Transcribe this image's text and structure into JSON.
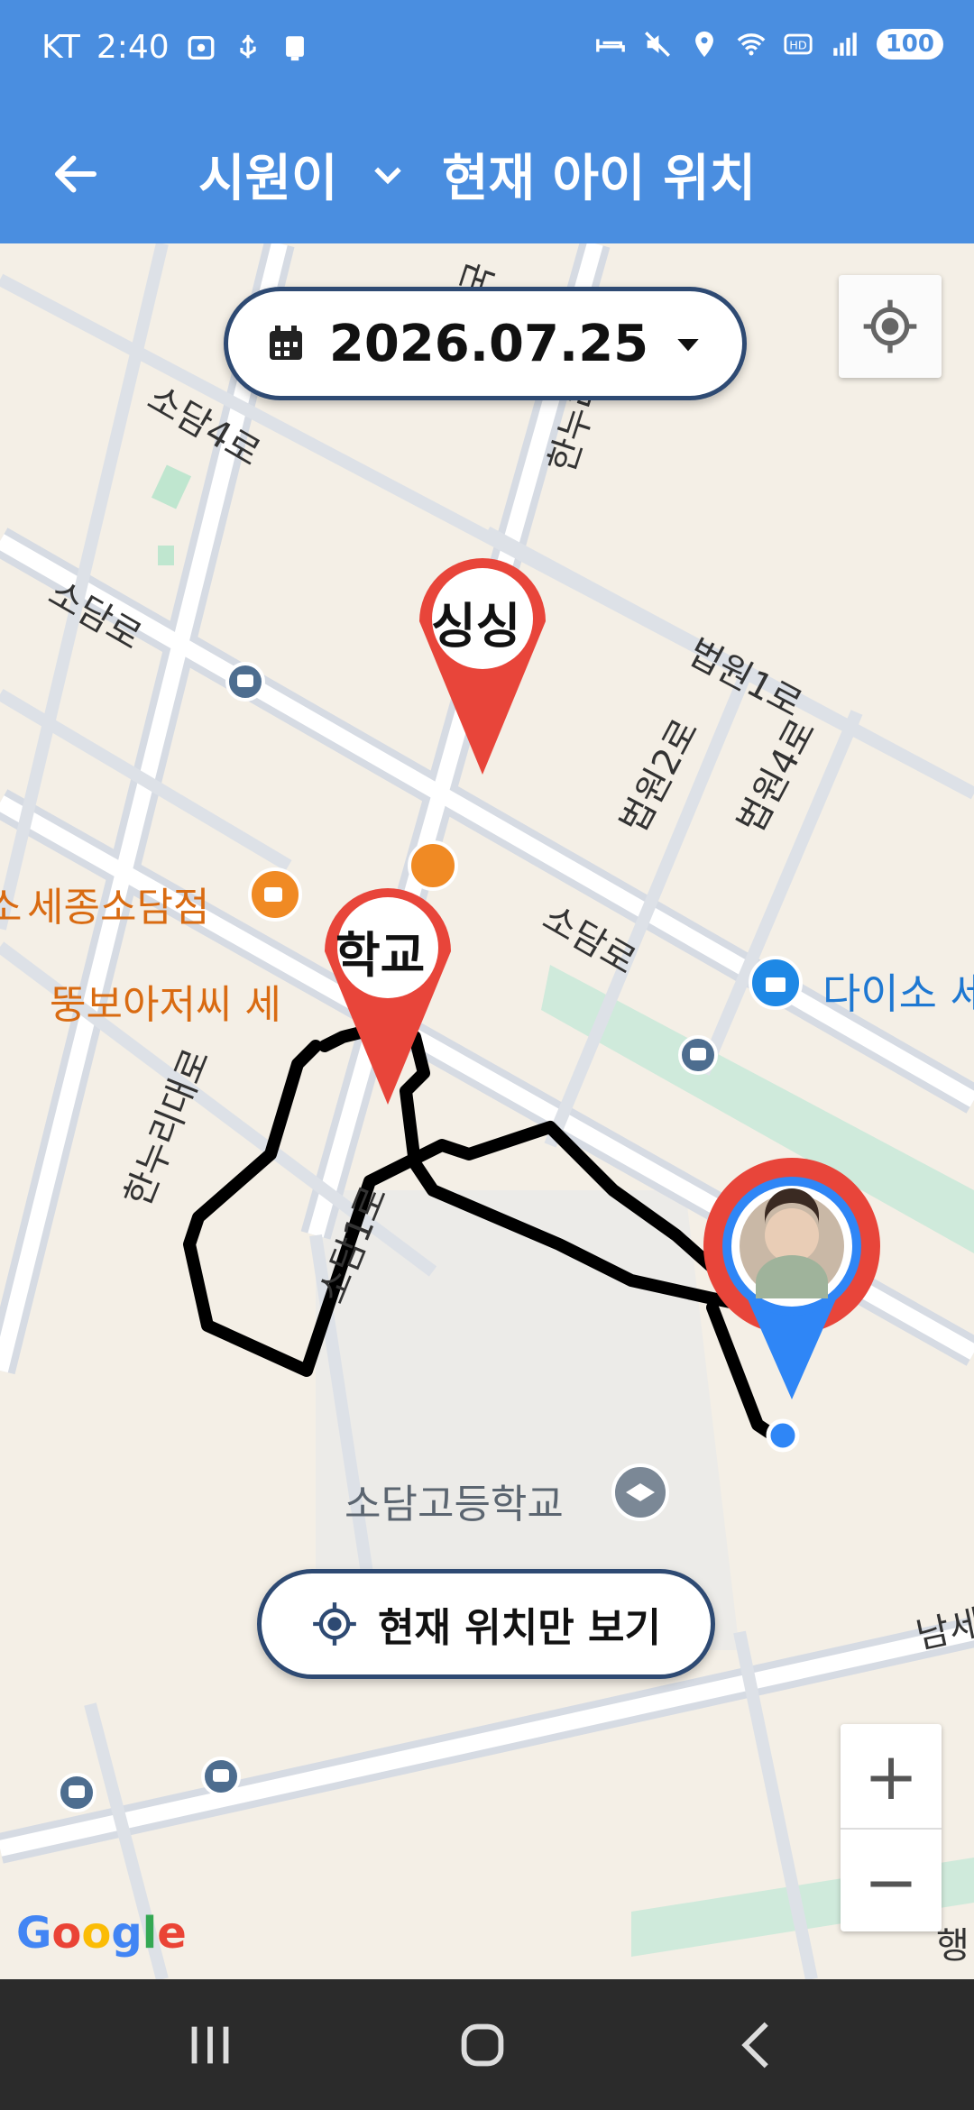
{
  "status": {
    "carrier": "KT",
    "time": "2:40",
    "battery": "100"
  },
  "header": {
    "child_name": "시원이",
    "title": "현재 아이 위치"
  },
  "date_picker": {
    "date": "2026.07.25"
  },
  "markers": {
    "place1": "싱싱",
    "place2": "학교"
  },
  "map_labels": {
    "road_sodam4": "소담4로",
    "road_sodam": "소담로",
    "road_sodam_2": "소담로",
    "road_beopwon1": "법원1로",
    "road_beopwon2": "법원2로",
    "road_beopwon4": "법원4로",
    "road_hannuridae": "한누리대로",
    "road_sodam1": "소담1로",
    "road_hannuri_top": "한누리",
    "road_guk": "국",
    "road_namse": "남세",
    "road_haeng": "행",
    "poi_sejong": "세종소담점",
    "poi_sejong_prefix": "소",
    "poi_ddung": "뚱보아저씨 세",
    "poi_daiso": "다이소 세",
    "poi_school": "소담고등학교"
  },
  "current_location_button": {
    "label": "현재 위치만 보기"
  },
  "zoom": {
    "in": "+",
    "out": "−"
  },
  "google": {
    "G": "G",
    "o1": "o",
    "o2": "o",
    "g": "g",
    "l": "l",
    "e": "e"
  },
  "colors": {
    "appbar": "#4a8ee0",
    "pill_border": "#2e4a73",
    "marker_red": "#e8453a",
    "route": "#000000"
  }
}
